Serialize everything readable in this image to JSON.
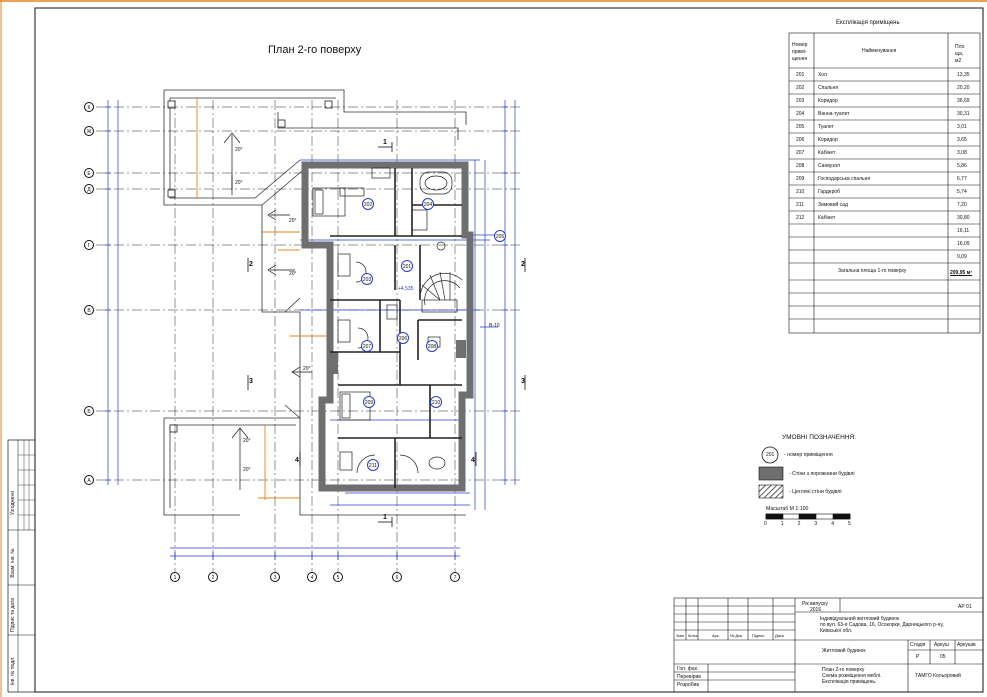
{
  "plan_title": "План 2-го поверху",
  "explication": {
    "title": "Експлікація приміщень",
    "head_number": [
      "Номер",
      "примі-",
      "щення"
    ],
    "head_name": "Найменування",
    "head_area": [
      "Пло",
      "ща,",
      "м2"
    ],
    "rows": [
      {
        "num": "201",
        "name": "Хол",
        "area": "13,35"
      },
      {
        "num": "202",
        "name": "Спальня",
        "area": "20,20"
      },
      {
        "num": "203",
        "name": "Коридор",
        "area": "36,69"
      },
      {
        "num": "204",
        "name": "Ванна-туалет",
        "area": "30,31"
      },
      {
        "num": "205",
        "name": "Туалет",
        "area": "3,01"
      },
      {
        "num": "206",
        "name": "Коридор",
        "area": "3,65"
      },
      {
        "num": "207",
        "name": "Кабінет",
        "area": "3,08"
      },
      {
        "num": "208",
        "name": "Санвузол",
        "area": "5,86"
      },
      {
        "num": "209",
        "name": "Господарська спальня",
        "area": "6,77"
      },
      {
        "num": "210",
        "name": "Гардероб",
        "area": "5,74"
      },
      {
        "num": "211",
        "name": "Зимовий сад",
        "area": "7,20"
      },
      {
        "num": "212",
        "name": "Кабінет",
        "area": "30,80"
      },
      {
        "num": "",
        "name": "",
        "area": "16,11"
      },
      {
        "num": "",
        "name": "",
        "area": "16,09"
      },
      {
        "num": "",
        "name": "",
        "area": "9,09"
      }
    ],
    "total_label": "Загальна площа 1-го поверху",
    "total_value": "209,95 м²"
  },
  "legend": {
    "title": "УМОВНІ ПОЗНАЧЕННЯ:",
    "room_symbol": "201",
    "room_text": "- номер приміщення",
    "wall_text": "- Стіни з порожнини будівлі",
    "partition_text": "- Цегляні стіни будівлі"
  },
  "scale": {
    "label": "Масштаб М 1:100",
    "ticks": [
      "0",
      "1",
      "2",
      "3",
      "4",
      "5"
    ]
  },
  "plan": {
    "row_axes": [
      "К",
      "Ж",
      "Е",
      "Д",
      "Г",
      "В",
      "Б",
      "А"
    ],
    "col_axes": [
      "1",
      "2",
      "3",
      "4",
      "5",
      "6",
      "7"
    ],
    "room_marks": [
      "202",
      "204",
      "205",
      "201",
      "203",
      "207",
      "206",
      "208",
      "209",
      "210",
      "211"
    ],
    "slope_labels": [
      "20°",
      "20°",
      "20°",
      "20°",
      "20°",
      "20°",
      "20°"
    ],
    "section_marks": [
      "1",
      "1",
      "2",
      "2",
      "3",
      "3",
      "4",
      "4"
    ],
    "level_mark": "+4,535",
    "b_label": "В-10"
  },
  "title_block": {
    "year_label": "Рік випуску",
    "year": "2016",
    "sheet_code": "АР 01",
    "project_lines": [
      "Індивідуальний житловий будинок",
      "по вул. 63-я Садова, 16, Осокорки, Дарницького р-ну,",
      "Київської обл."
    ],
    "col_heads": [
      "Змін",
      "Кільк.",
      "Арк.",
      "№ Док.",
      "Підпис",
      "Дата"
    ],
    "object": "Житловий будинок",
    "stage_heads": [
      "Стадія",
      "Аркуш",
      "Аркушів"
    ],
    "stage_vals": [
      "Р",
      "05",
      ""
    ],
    "roles": [
      "Гол. фах.",
      "Перевірив",
      "Розробив"
    ],
    "sheet_lines": [
      "План 2-го поверху",
      "Схема розміщення меблі.",
      "Експлікація приміщень."
    ],
    "company": "ТАМГО Кольоровий"
  },
  "side_stamp": [
    "Узгоджено",
    "Взам. інв. №",
    "Підпис та дата",
    "Інв. № подл."
  ],
  "colors": {
    "dimension_blue": "#2a3bcf",
    "accent_orange": "#e8801e",
    "wall_gray": "#6f6f6f",
    "line_black": "#111111"
  }
}
